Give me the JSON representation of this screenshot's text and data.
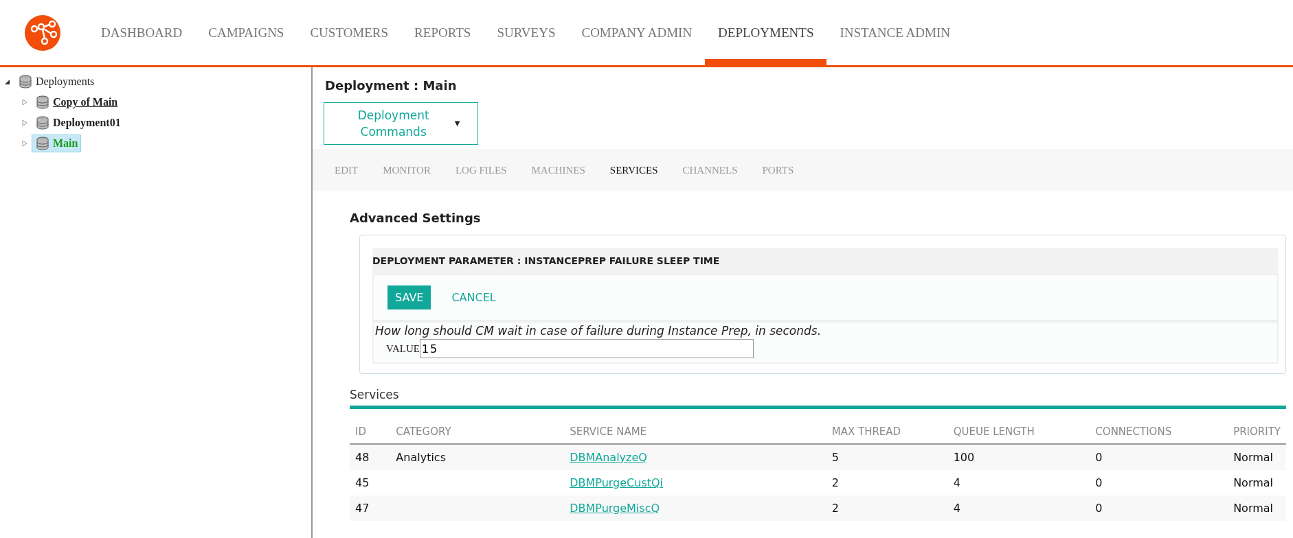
{
  "nav": [
    {
      "label": "DASHBOARD",
      "selected": false
    },
    {
      "label": "CAMPAIGNS",
      "selected": false
    },
    {
      "label": "CUSTOMERS",
      "selected": false
    },
    {
      "label": "REPORTS",
      "selected": false
    },
    {
      "label": "SURVEYS",
      "selected": false
    },
    {
      "label": "COMPANY ADMIN",
      "selected": false
    },
    {
      "label": "DEPLOYMENTS",
      "selected": true
    },
    {
      "label": "INSTANCE ADMIN",
      "selected": false
    }
  ],
  "tree": {
    "label": "Deployments",
    "expanded": true,
    "children": [
      {
        "label": "Copy of Main",
        "expanded": false,
        "selected": false,
        "hovered": true
      },
      {
        "label": "Deployment01",
        "expanded": false,
        "selected": false,
        "hovered": false
      },
      {
        "label": "Main",
        "expanded": false,
        "selected": true,
        "hovered": false
      }
    ]
  },
  "page_title": "Deployment : Main",
  "commands_dropdown": "Deployment Commands",
  "caret": "▼",
  "subtabs": [
    {
      "label": "EDIT",
      "selected": false
    },
    {
      "label": "MONITOR",
      "selected": false
    },
    {
      "label": "LOG FILES",
      "selected": false
    },
    {
      "label": "MACHINES",
      "selected": false
    },
    {
      "label": "SERVICES",
      "selected": true
    },
    {
      "label": "CHANNELS",
      "selected": false
    },
    {
      "label": "PORTS",
      "selected": false
    }
  ],
  "advanced": {
    "title": "Advanced Settings",
    "param_title": "DEPLOYMENT PARAMETER : INSTANCEPREP FAILURE SLEEP TIME",
    "save": "SAVE",
    "cancel": "CANCEL",
    "description": "How long should CM wait in case of failure during Instance Prep, in seconds.",
    "value_label": "VALUE",
    "value": "15"
  },
  "services": {
    "title": "Services",
    "columns": [
      "ID",
      "CATEGORY",
      "SERVICE NAME",
      "MAX THREAD",
      "QUEUE LENGTH",
      "CONNECTIONS",
      "PRIORITY"
    ],
    "rows": [
      [
        "48",
        "Analytics",
        "DBMAnalyzeQ",
        "5",
        "100",
        "0",
        "Normal"
      ],
      [
        "45",
        "",
        "DBMPurgeCustQi",
        "2",
        "4",
        "0",
        "Normal"
      ],
      [
        "47",
        "",
        "DBMPurgeMiscQ",
        "2",
        "4",
        "0",
        "Normal"
      ]
    ]
  }
}
